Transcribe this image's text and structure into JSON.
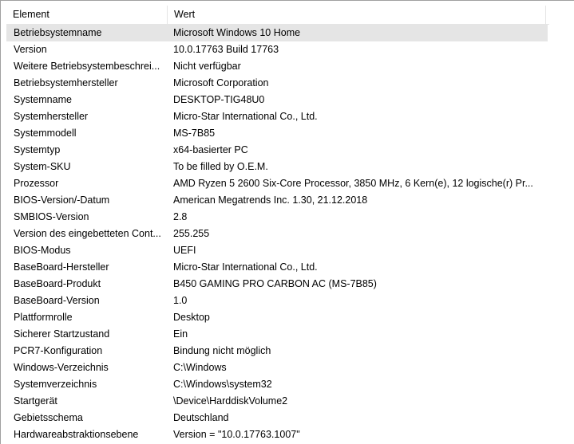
{
  "header": {
    "col_element": "Element",
    "col_value": "Wert"
  },
  "rows": [
    {
      "name": "Betriebsystemname",
      "value": "Microsoft Windows 10 Home"
    },
    {
      "name": "Version",
      "value": "10.0.17763 Build 17763"
    },
    {
      "name": "Weitere Betriebsystembeschrei...",
      "value": "Nicht verfügbar"
    },
    {
      "name": "Betriebsystemhersteller",
      "value": "Microsoft Corporation"
    },
    {
      "name": "Systemname",
      "value": "DESKTOP-TIG48U0"
    },
    {
      "name": "Systemhersteller",
      "value": "Micro-Star International Co., Ltd."
    },
    {
      "name": "Systemmodell",
      "value": "MS-7B85"
    },
    {
      "name": "Systemtyp",
      "value": "x64-basierter PC"
    },
    {
      "name": "System-SKU",
      "value": "To be filled by O.E.M."
    },
    {
      "name": "Prozessor",
      "value": "AMD Ryzen 5 2600 Six-Core Processor, 3850 MHz, 6 Kern(e), 12 logische(r) Pr..."
    },
    {
      "name": "BIOS-Version/-Datum",
      "value": "American Megatrends Inc. 1.30, 21.12.2018"
    },
    {
      "name": "SMBIOS-Version",
      "value": "2.8"
    },
    {
      "name": "Version des eingebetteten Cont...",
      "value": "255.255"
    },
    {
      "name": "BIOS-Modus",
      "value": "UEFI"
    },
    {
      "name": "BaseBoard-Hersteller",
      "value": "Micro-Star International Co., Ltd."
    },
    {
      "name": "BaseBoard-Produkt",
      "value": "B450 GAMING PRO CARBON AC (MS-7B85)"
    },
    {
      "name": "BaseBoard-Version",
      "value": "1.0"
    },
    {
      "name": "Plattformrolle",
      "value": "Desktop"
    },
    {
      "name": "Sicherer Startzustand",
      "value": "Ein"
    },
    {
      "name": "PCR7-Konfiguration",
      "value": "Bindung nicht möglich"
    },
    {
      "name": "Windows-Verzeichnis",
      "value": "C:\\Windows"
    },
    {
      "name": "Systemverzeichnis",
      "value": "C:\\Windows\\system32"
    },
    {
      "name": "Startgerät",
      "value": "\\Device\\HarddiskVolume2"
    },
    {
      "name": "Gebietsschema",
      "value": "Deutschland"
    },
    {
      "name": "Hardwareabstraktionsebene",
      "value": "Version = \"10.0.17763.1007\""
    }
  ]
}
